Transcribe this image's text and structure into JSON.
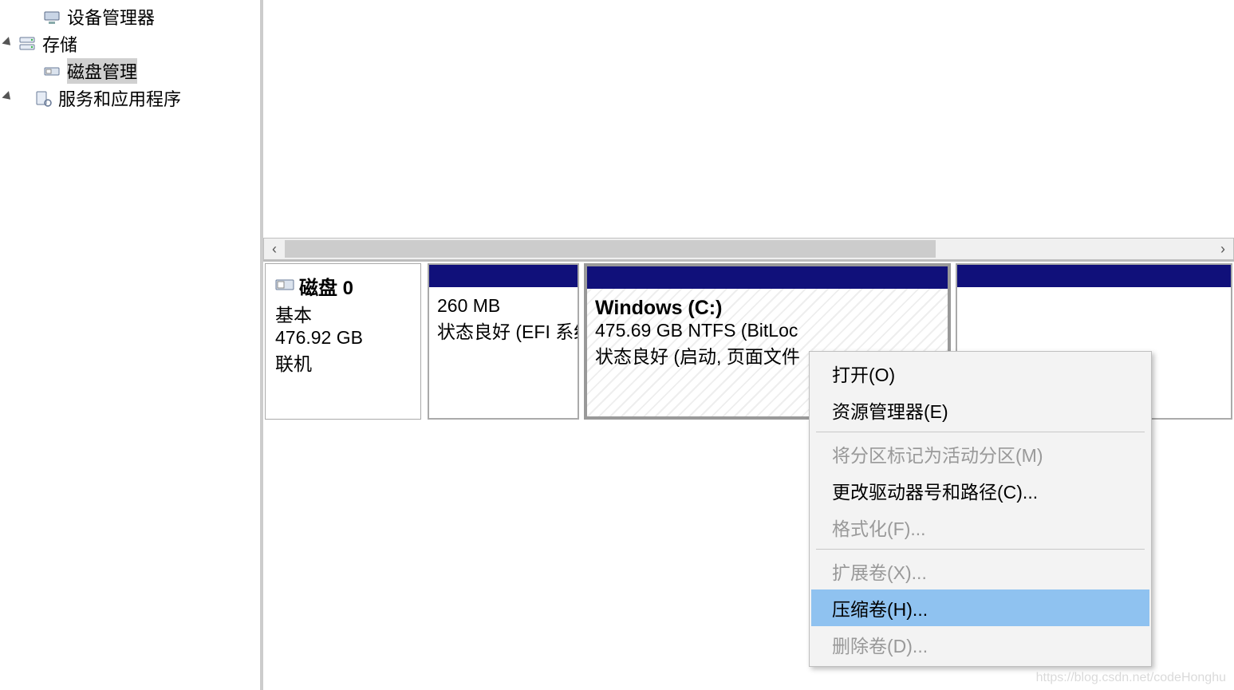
{
  "sidebar": {
    "items": [
      {
        "label": "设备管理器",
        "icon": "device-manager-icon"
      },
      {
        "label": "存储",
        "icon": "storage-icon"
      },
      {
        "label": "磁盘管理",
        "icon": "disk-mgmt-icon"
      },
      {
        "label": "服务和应用程序",
        "icon": "services-icon"
      }
    ]
  },
  "disk": {
    "name": "磁盘 0",
    "type": "基本",
    "size": "476.92 GB",
    "status": "联机"
  },
  "partitions": [
    {
      "vol_name": "",
      "line1": "260 MB",
      "line2": "状态良好 (EFI 系统"
    },
    {
      "vol_name": "Windows  (C:)",
      "line1": "475.69 GB NTFS (BitLoc",
      "line2": "状态良好 (启动, 页面文件"
    },
    {
      "vol_name": "",
      "line1": "",
      "line2": ""
    }
  ],
  "context_menu": {
    "items": [
      {
        "label": "打开(O)",
        "enabled": true
      },
      {
        "label": "资源管理器(E)",
        "enabled": true
      },
      {
        "sep": true
      },
      {
        "label": "将分区标记为活动分区(M)",
        "enabled": false
      },
      {
        "label": "更改驱动器号和路径(C)...",
        "enabled": true
      },
      {
        "label": "格式化(F)...",
        "enabled": false
      },
      {
        "sep": true
      },
      {
        "label": "扩展卷(X)...",
        "enabled": false
      },
      {
        "label": "压缩卷(H)...",
        "enabled": true,
        "highlight": true
      },
      {
        "label": "删除卷(D)...",
        "enabled": false
      }
    ]
  },
  "watermark": "https://blog.csdn.net/codeHonghu"
}
